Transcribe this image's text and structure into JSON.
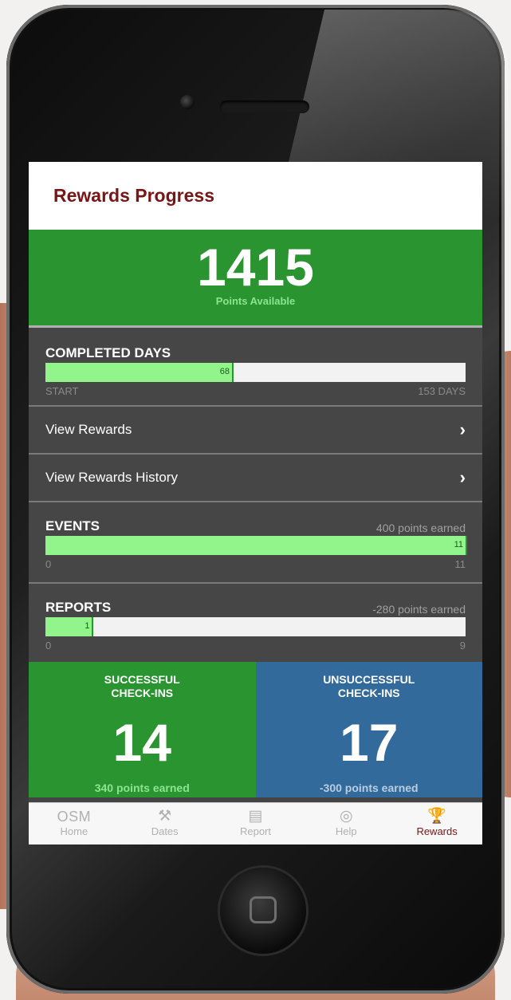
{
  "screen": {
    "header": {
      "title": "Rewards Progress"
    },
    "points": {
      "value": "1415",
      "label": "Points Available"
    },
    "completed_days": {
      "title": "COMPLETED DAYS",
      "value": "68",
      "fill_fraction": 0.444,
      "start_label": "START",
      "end_label": "153 DAYS"
    },
    "links": [
      {
        "label": "View Rewards"
      },
      {
        "label": "View Rewards History"
      }
    ],
    "events": {
      "title": "EVENTS",
      "points_text": "400 points earned",
      "value": "11",
      "fill_fraction": 1.0,
      "min": "0",
      "max": "11"
    },
    "reports": {
      "title": "REPORTS",
      "points_text": "-280 points earned",
      "value": "1",
      "fill_fraction": 0.111,
      "min": "0",
      "max": "9"
    },
    "successful": {
      "title": "SUCCESSFUL\nCHECK-INS",
      "value": "14",
      "points_text": "340 points earned"
    },
    "unsuccessful": {
      "title": "UNSUCCESSFUL\nCHECK-INS",
      "value": "17",
      "points_text": "-300 points earned"
    },
    "tabs": [
      {
        "icon": "osm-logo",
        "glyph": "OSM",
        "label": "Home"
      },
      {
        "icon": "gavel-icon",
        "glyph": "⚒",
        "label": "Dates"
      },
      {
        "icon": "document-icon",
        "glyph": "▤",
        "label": "Report"
      },
      {
        "icon": "lifebuoy-icon",
        "glyph": "◎",
        "label": "Help"
      },
      {
        "icon": "trophy-icon",
        "glyph": "🏆",
        "label": "Rewards",
        "active": true
      }
    ]
  },
  "colors": {
    "header_title": "#7a1515",
    "green": "#2a9430",
    "blue": "#336a9c",
    "progress_fill": "#92f58c"
  }
}
